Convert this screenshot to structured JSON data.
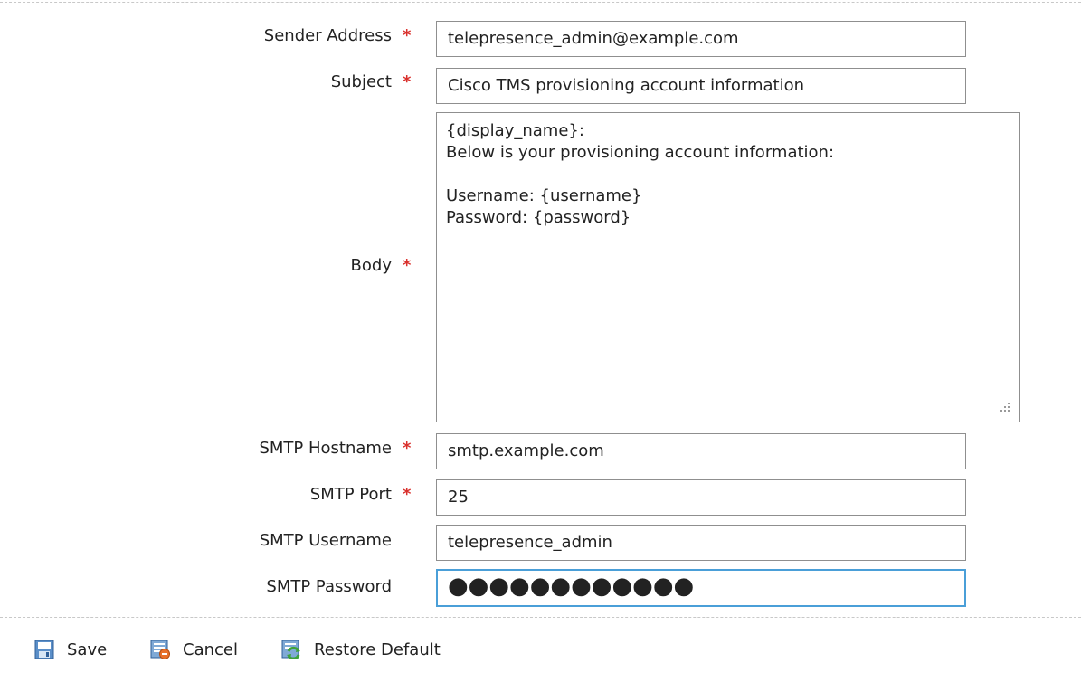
{
  "form": {
    "sender_address": {
      "label": "Sender Address",
      "required_mark": "*",
      "value": "telepresence_admin@example.com"
    },
    "subject": {
      "label": "Subject",
      "required_mark": "*",
      "value": "Cisco TMS provisioning account information"
    },
    "body": {
      "label": "Body",
      "required_mark": "*",
      "lines": [
        "{display_name}:",
        "Below is your provisioning account information:",
        "",
        "Username: {username}",
        "Password: {password}"
      ]
    },
    "smtp_hostname": {
      "label": "SMTP Hostname",
      "required_mark": "*",
      "value": "smtp.example.com"
    },
    "smtp_port": {
      "label": "SMTP Port",
      "required_mark": "*",
      "value": "25"
    },
    "smtp_username": {
      "label": "SMTP Username",
      "value": "telepresence_admin"
    },
    "smtp_password": {
      "label": "SMTP Password",
      "value": "●●●●●●●●●●●●"
    }
  },
  "toolbar": {
    "save_label": "Save",
    "cancel_label": "Cancel",
    "restore_label": "Restore Default"
  },
  "icons": {
    "save": "save-icon",
    "cancel": "cancel-icon",
    "restore": "restore-default-icon",
    "resize": "resize-grip-icon"
  },
  "colors": {
    "required": "#d9302c",
    "focus_border": "#4a9fd8",
    "field_border": "#8f8f8f"
  }
}
